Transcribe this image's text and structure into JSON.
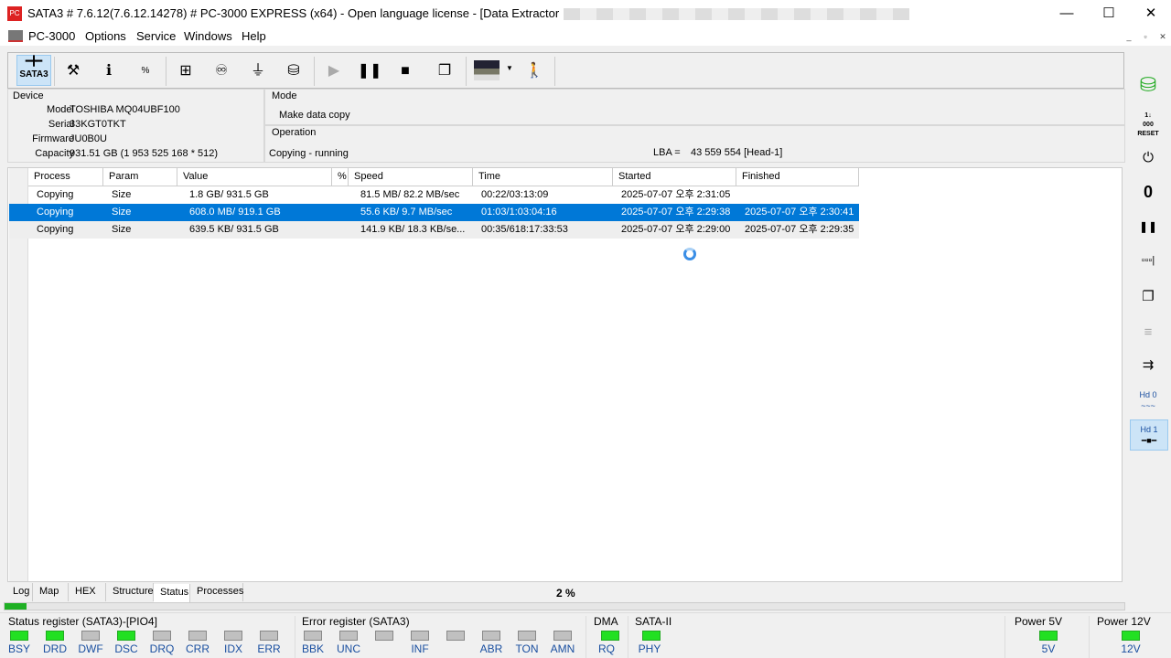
{
  "window": {
    "title": "SATA3 # 7.6.12(7.6.12.14278) # PC-3000 EXPRESS (x64) - Open language license - [Data Extractor : Task -",
    "minimize": "—",
    "maximize": "☐",
    "close": "✕"
  },
  "menu": [
    "PC-3000",
    "Options",
    "Service",
    "Windows",
    "Help"
  ],
  "toolbar": {
    "sata_label": "SATA3"
  },
  "device": {
    "title": "Device",
    "fields": [
      {
        "label": "Model",
        "value": "TOSHIBA MQ04UBF100"
      },
      {
        "label": "Serial",
        "value": "33KGT0TKT"
      },
      {
        "label": "Firmware",
        "value": "JU0B0U"
      },
      {
        "label": "Capacity",
        "value": "931.51 GB (1 953 525 168 * 512)"
      }
    ]
  },
  "mode": {
    "title": "Mode",
    "value": "Make data copy"
  },
  "operation": {
    "title": "Operation",
    "status": "Copying - running",
    "lba_label": "LBA =",
    "lba_value": "43 559 554  [Head-1]"
  },
  "table": {
    "columns": [
      "Process",
      "Param",
      "Value",
      "%",
      "Speed",
      "Time",
      "Started",
      "Finished"
    ],
    "rows": [
      [
        "Copying",
        "Size",
        "1.8 GB/ 931.5 GB",
        "",
        "81.5 MB/ 82.2 MB/sec",
        "00:22/03:13:09",
        "2025-07-07 오후 2:31:05",
        ""
      ],
      [
        "Copying",
        "Size",
        "608.0 MB/ 919.1 GB",
        "",
        "55.6 KB/ 9.7 MB/sec",
        "01:03/1:03:04:16",
        "2025-07-07 오후 2:29:38",
        "2025-07-07 오후 2:30:41"
      ],
      [
        "Copying",
        "Size",
        "639.5 KB/ 931.5 GB",
        "",
        "141.9 KB/ 18.3 KB/se...",
        "00:35/618:17:33:53",
        "2025-07-07 오후 2:29:00",
        "2025-07-07 오후 2:29:35"
      ]
    ],
    "selected_row": 1
  },
  "tabs": [
    "Log",
    "Map",
    "HEX",
    "Structure",
    "Status",
    "Processes"
  ],
  "active_tab": "Status",
  "progress": {
    "label": "2 %",
    "value": 2
  },
  "status_register": {
    "title": "Status register (SATA3)-[PIO4]",
    "leds": [
      {
        "name": "BSY",
        "on": true
      },
      {
        "name": "DRD",
        "on": true
      },
      {
        "name": "DWF",
        "on": false
      },
      {
        "name": "DSC",
        "on": true
      },
      {
        "name": "DRQ",
        "on": false
      },
      {
        "name": "CRR",
        "on": false
      },
      {
        "name": "IDX",
        "on": false
      },
      {
        "name": "ERR",
        "on": false
      }
    ]
  },
  "error_register": {
    "title": "Error register (SATA3)",
    "leds": [
      {
        "name": "BBK",
        "on": false
      },
      {
        "name": "UNC",
        "on": false
      },
      {
        "name": "",
        "on": false
      },
      {
        "name": "INF",
        "on": false
      },
      {
        "name": "",
        "on": false
      },
      {
        "name": "ABR",
        "on": false
      },
      {
        "name": "TON",
        "on": false
      },
      {
        "name": "AMN",
        "on": false
      }
    ]
  },
  "dma": {
    "title": "DMA",
    "led": "RQ",
    "on": true
  },
  "sata": {
    "title": "SATA-II",
    "led": "PHY",
    "on": true
  },
  "power5": {
    "title": "Power 5V",
    "led": "5V",
    "on": true
  },
  "power12": {
    "title": "Power 12V",
    "led": "12V",
    "on": true
  },
  "right_toolbar": {
    "hd0": "Hd 0",
    "hd1": "Hd 1",
    "reset": "RESET"
  }
}
